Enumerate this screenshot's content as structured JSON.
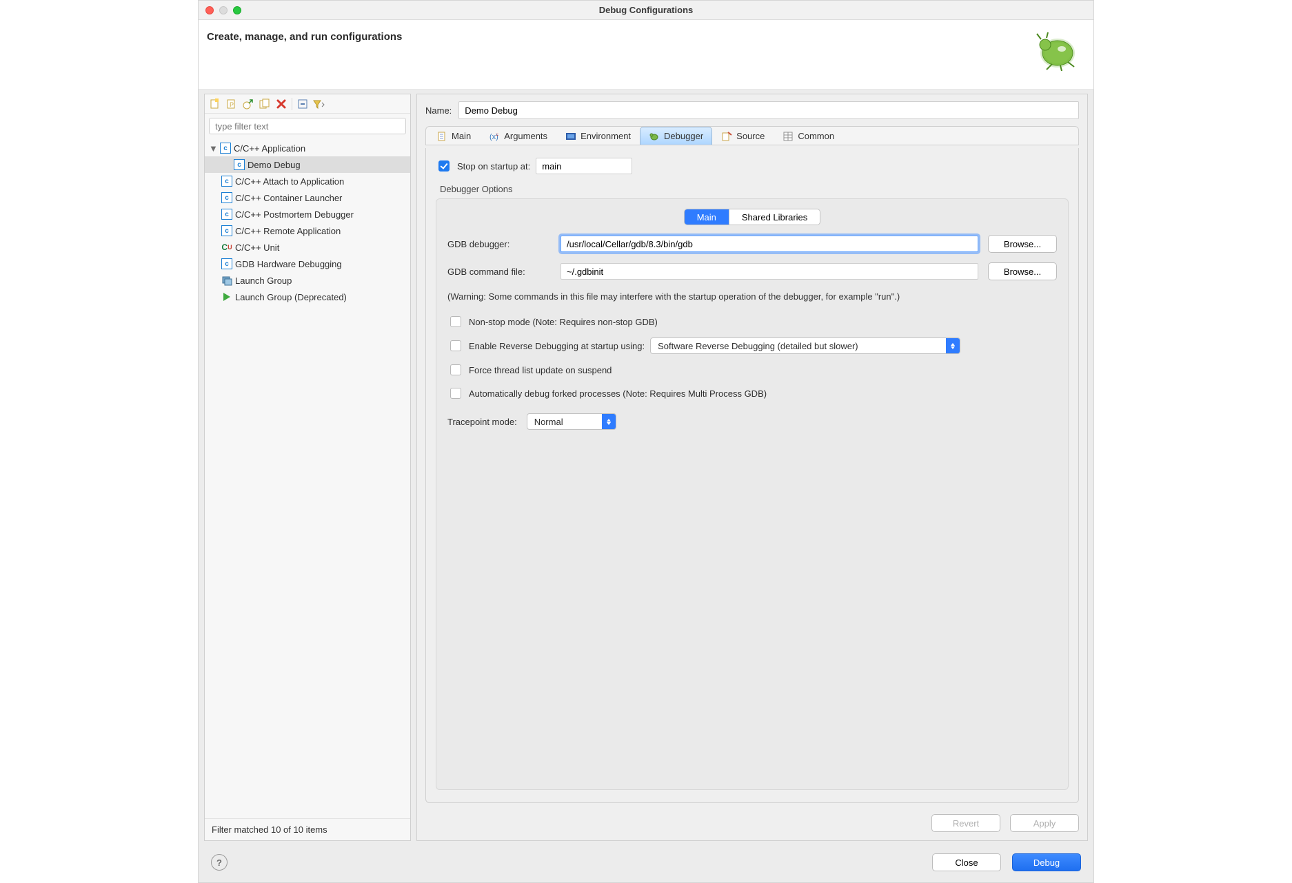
{
  "window_title": "Debug Configurations",
  "header_title": "Create, manage, and run configurations",
  "filter_placeholder": "type filter text",
  "tree": {
    "items": [
      {
        "label": "C/C++ Application"
      },
      {
        "label": "Demo Debug"
      },
      {
        "label": "C/C++ Attach to Application"
      },
      {
        "label": "C/C++ Container Launcher"
      },
      {
        "label": "C/C++ Postmortem Debugger"
      },
      {
        "label": "C/C++ Remote Application"
      },
      {
        "label": "C/C++ Unit"
      },
      {
        "label": "GDB Hardware Debugging"
      },
      {
        "label": "Launch Group"
      },
      {
        "label": "Launch Group (Deprecated)"
      }
    ]
  },
  "filter_status": "Filter matched 10 of 10 items",
  "name_label": "Name:",
  "name_value": "Demo Debug",
  "tabs": {
    "main": "Main",
    "arguments": "Arguments",
    "environment": "Environment",
    "debugger": "Debugger",
    "source": "Source",
    "common": "Common"
  },
  "debugger": {
    "stop_label": "Stop on startup at:",
    "stop_value": "main",
    "options_title": "Debugger Options",
    "seg_main": "Main",
    "seg_shared": "Shared Libraries",
    "gdb_debugger_label": "GDB debugger:",
    "gdb_debugger_value": "/usr/local/Cellar/gdb/8.3/bin/gdb",
    "gdb_cmd_label": "GDB command file:",
    "gdb_cmd_value": "~/.gdbinit",
    "browse": "Browse...",
    "warning": "(Warning: Some commands in this file may interfere with the startup operation of the debugger, for example \"run\".)",
    "nonstop": "Non-stop mode (Note: Requires non-stop GDB)",
    "reverse_label": "Enable Reverse Debugging at startup using:",
    "reverse_select": "Software Reverse Debugging (detailed but slower)",
    "force_thread": "Force thread list update on suspend",
    "auto_fork": "Automatically debug forked processes (Note: Requires Multi Process GDB)",
    "tracepoint_label": "Tracepoint mode:",
    "tracepoint_value": "Normal"
  },
  "buttons": {
    "revert": "Revert",
    "apply": "Apply",
    "close": "Close",
    "debug": "Debug"
  }
}
